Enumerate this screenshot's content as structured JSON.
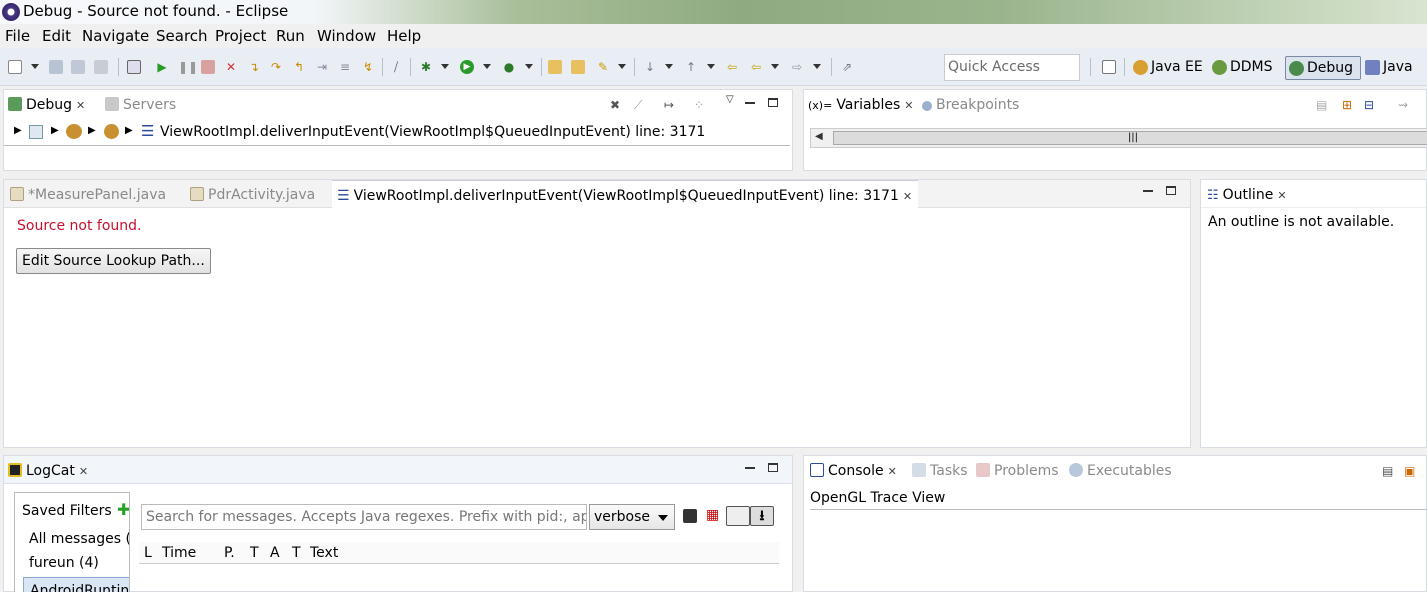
{
  "window": {
    "title": "Debug - Source not found. - Eclipse"
  },
  "menu": [
    "File",
    "Edit",
    "Navigate",
    "Search",
    "Project",
    "Run",
    "Window",
    "Help"
  ],
  "toolbar": {
    "quick_access_placeholder": "Quick Access"
  },
  "perspectives": [
    {
      "label": "Java EE",
      "icon": "java-ee-icon",
      "active": false
    },
    {
      "label": "DDMS",
      "icon": "ddms-icon",
      "active": false
    },
    {
      "label": "Debug",
      "icon": "debug-icon",
      "active": true
    },
    {
      "label": "Java",
      "icon": "java-icon",
      "active": false
    }
  ],
  "debug_view": {
    "tabs": [
      {
        "label": "Debug",
        "active": true
      },
      {
        "label": "Servers",
        "active": false
      }
    ],
    "stack_frame": "ViewRootImpl.deliverInputEvent(ViewRootImpl$QueuedInputEvent) line: 3171"
  },
  "variables_view": {
    "tabs": [
      {
        "label": "Variables",
        "active": true
      },
      {
        "label": "Breakpoints",
        "active": false
      }
    ],
    "scroll_thumb": "|||"
  },
  "editor": {
    "tabs": [
      {
        "label": "*MeasurePanel.java",
        "active": false
      },
      {
        "label": "PdrActivity.java",
        "active": false
      },
      {
        "label": "ViewRootImpl.deliverInputEvent(ViewRootImpl$QueuedInputEvent) line: 3171",
        "active": true
      }
    ],
    "message": "Source not found.",
    "button": "Edit Source Lookup Path..."
  },
  "outline_view": {
    "tab": "Outline",
    "message": "An outline is not available."
  },
  "logcat_view": {
    "tab": "LogCat",
    "saved_filters_label": "Saved Filters",
    "filters": [
      "All messages (",
      "fureun (4)",
      "AndroidRuntin"
    ],
    "search_placeholder": "Search for messages. Accepts Java regexes. Prefix with pid:, app",
    "level_select": "verbose",
    "columns": [
      "L",
      "Time",
      "P.",
      "T",
      "A",
      "T",
      "Text"
    ]
  },
  "console_view": {
    "tabs": [
      {
        "label": "Console",
        "active": true
      },
      {
        "label": "Tasks",
        "active": false
      },
      {
        "label": "Problems",
        "active": false
      },
      {
        "label": "Executables",
        "active": false
      }
    ],
    "content_title": "OpenGL Trace View"
  }
}
